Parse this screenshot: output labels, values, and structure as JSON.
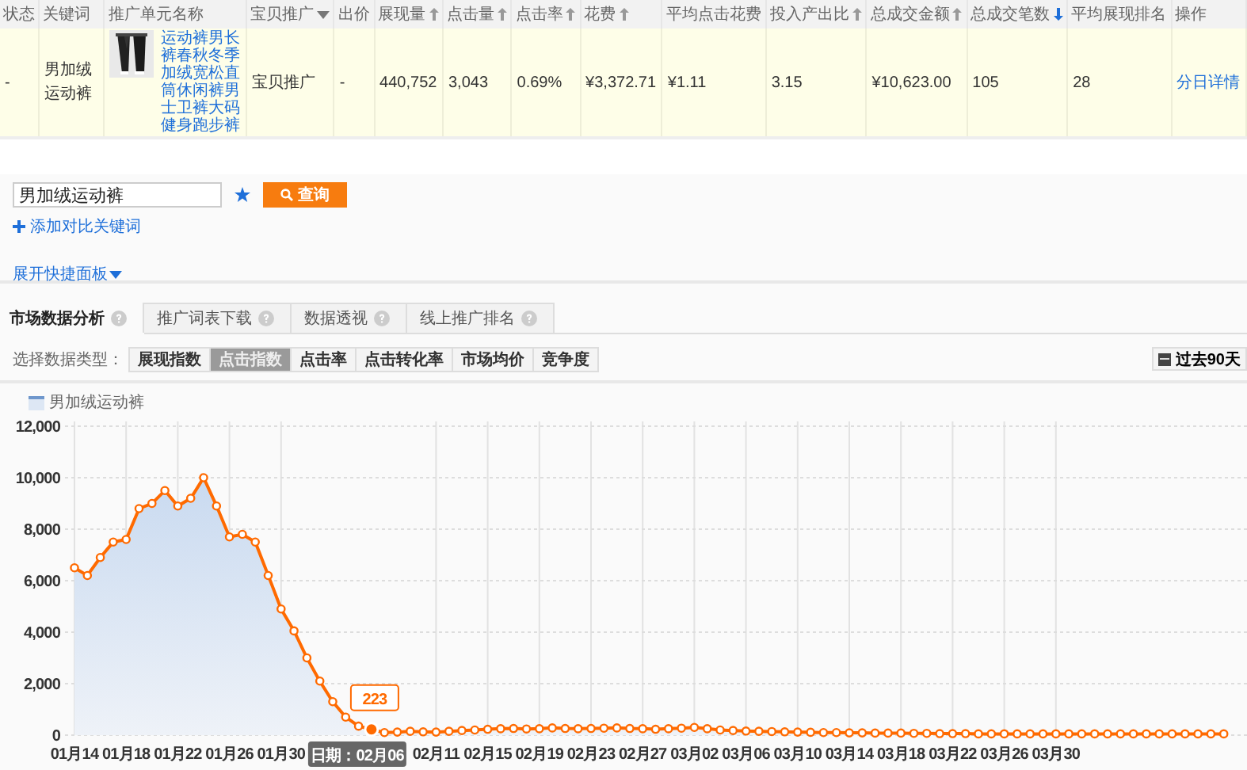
{
  "table": {
    "columns": [
      {
        "label": "状态",
        "kind": "plain"
      },
      {
        "label": "关键词",
        "kind": "plain"
      },
      {
        "label": "推广单元名称",
        "kind": "plain"
      },
      {
        "label": "宝贝推广",
        "kind": "menu"
      },
      {
        "label": "出价",
        "kind": "plain"
      },
      {
        "label": "展现量",
        "kind": "sortable"
      },
      {
        "label": "点击量",
        "kind": "sortable"
      },
      {
        "label": "点击率",
        "kind": "sortable"
      },
      {
        "label": "花费",
        "kind": "sortable"
      },
      {
        "label": "平均点击花费",
        "kind": "plain"
      },
      {
        "label": "投入产出比",
        "kind": "sortable"
      },
      {
        "label": "总成交金额",
        "kind": "sortable"
      },
      {
        "label": "总成交笔数",
        "kind": "sorted"
      },
      {
        "label": "平均展现排名",
        "kind": "plain"
      },
      {
        "label": "操作",
        "kind": "plain"
      }
    ],
    "rows": [
      {
        "cells": [
          {
            "kind": "text",
            "text": "-"
          },
          {
            "kind": "text",
            "text": "男加绒运动裤"
          },
          {
            "kind": "product",
            "text": "运动裤男长裤春秋冬季加绒宽松直筒休闲裤男士卫裤大码健身跑步裤"
          },
          {
            "kind": "text",
            "text": "宝贝推广"
          },
          {
            "kind": "text",
            "text": "-"
          },
          {
            "kind": "text",
            "text": "440,752"
          },
          {
            "kind": "text",
            "text": "3,043"
          },
          {
            "kind": "text",
            "text": "0.69%"
          },
          {
            "kind": "text",
            "text": "¥3,372.71"
          },
          {
            "kind": "text",
            "text": "¥1.11"
          },
          {
            "kind": "text",
            "text": "3.15"
          },
          {
            "kind": "text",
            "text": "¥10,623.00"
          },
          {
            "kind": "text",
            "text": "105"
          },
          {
            "kind": "text",
            "text": "28"
          },
          {
            "kind": "link",
            "text": "分日详情"
          }
        ]
      }
    ]
  },
  "search": {
    "value": "男加绒运动裤",
    "button": "查询"
  },
  "add_compare": "添加对比关键词",
  "expand_panel": "展开快捷面板",
  "tabs": [
    {
      "label": "市场数据分析",
      "selected": true
    },
    {
      "label": "推广词表下载",
      "selected": false
    },
    {
      "label": "数据透视",
      "selected": false
    },
    {
      "label": "线上推广排名",
      "selected": false
    }
  ],
  "data_type": {
    "label": "选择数据类型：",
    "options": [
      {
        "label": "展现指数",
        "selected": false
      },
      {
        "label": "点击指数",
        "selected": true
      },
      {
        "label": "点击率",
        "selected": false
      },
      {
        "label": "点击转化率",
        "selected": false
      },
      {
        "label": "市场均价",
        "selected": false
      },
      {
        "label": "竞争度",
        "selected": false
      }
    ]
  },
  "range_button": "过去90天",
  "chart": {
    "chart_data": {
      "type": "area",
      "categories": [
        "01月14",
        null,
        null,
        null,
        "01月18",
        null,
        null,
        null,
        "01月22",
        null,
        null,
        null,
        "01月26",
        null,
        null,
        null,
        "01月30",
        null,
        null,
        null,
        null,
        null,
        null,
        null,
        null,
        null,
        null,
        null,
        "02月11",
        null,
        null,
        null,
        "02月15",
        null,
        null,
        null,
        "02月19",
        null,
        null,
        null,
        "02月23",
        null,
        null,
        null,
        "02月27",
        null,
        null,
        null,
        "03月02",
        null,
        null,
        null,
        "03月06",
        null,
        null,
        null,
        "03月10",
        null,
        null,
        null,
        "03月14",
        null,
        null,
        null,
        "03月18",
        null,
        null,
        null,
        "03月22",
        null,
        null,
        null,
        "03月26",
        null,
        null,
        null,
        "03月30",
        null,
        null,
        null,
        null,
        null,
        null,
        null,
        null,
        null,
        null,
        null,
        null,
        null
      ],
      "series": [
        {
          "name": "男加绒运动裤",
          "color": "#ff6a00",
          "values": [
            6500,
            6200,
            6900,
            7500,
            7600,
            8800,
            9000,
            9500,
            8900,
            9200,
            10000,
            8900,
            7700,
            7800,
            7500,
            6200,
            4900,
            4050,
            3000,
            2100,
            1300,
            700,
            350,
            223,
            100,
            120,
            150,
            130,
            120,
            150,
            180,
            200,
            230,
            250,
            260,
            240,
            250,
            280,
            260,
            250,
            260,
            270,
            280,
            260,
            250,
            230,
            250,
            270,
            300,
            250,
            200,
            180,
            160,
            150,
            140,
            130,
            120,
            110,
            100,
            100,
            90,
            90,
            80,
            80,
            80,
            70,
            70,
            60,
            60,
            60,
            50,
            50,
            50,
            50,
            50,
            50,
            50,
            50,
            50,
            50,
            50,
            50,
            50,
            50,
            50,
            50,
            50,
            50,
            50,
            50
          ]
        }
      ],
      "ylim": [
        0,
        12000
      ],
      "yticks": [
        {
          "value": 0,
          "label": "0"
        },
        {
          "value": 2000,
          "label": "2,000"
        },
        {
          "value": 4000,
          "label": "4,000"
        },
        {
          "value": 6000,
          "label": "6,000"
        },
        {
          "value": 8000,
          "label": "8,000"
        },
        {
          "value": 10000,
          "label": "10,000"
        },
        {
          "value": 12000,
          "label": "12,000"
        }
      ],
      "grid": true,
      "annotations": [
        {
          "y": 223,
          "text": "223"
        }
      ]
    },
    "date_tooltip": "日期：02月06"
  }
}
